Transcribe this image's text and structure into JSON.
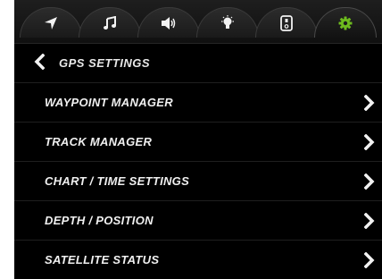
{
  "tabs": [
    {
      "icon": "navigation-arrow-icon"
    },
    {
      "icon": "music-note-icon"
    },
    {
      "icon": "speaker-volume-icon"
    },
    {
      "icon": "light-bulb-icon"
    },
    {
      "icon": "remote-device-icon"
    },
    {
      "icon": "gear-icon",
      "active": true,
      "accent": "#6dbb1e"
    }
  ],
  "header": {
    "title": "GPS SETTINGS"
  },
  "menu": {
    "items": [
      {
        "label": "WAYPOINT MANAGER"
      },
      {
        "label": "TRACK MANAGER"
      },
      {
        "label": "CHART / TIME SETTINGS"
      },
      {
        "label": "DEPTH / POSITION"
      },
      {
        "label": "SATELLITE STATUS"
      }
    ]
  },
  "colors": {
    "background": "#000000",
    "text": "#f0f0f0",
    "accent": "#6dbb1e",
    "divider": "#1f1f1f"
  }
}
